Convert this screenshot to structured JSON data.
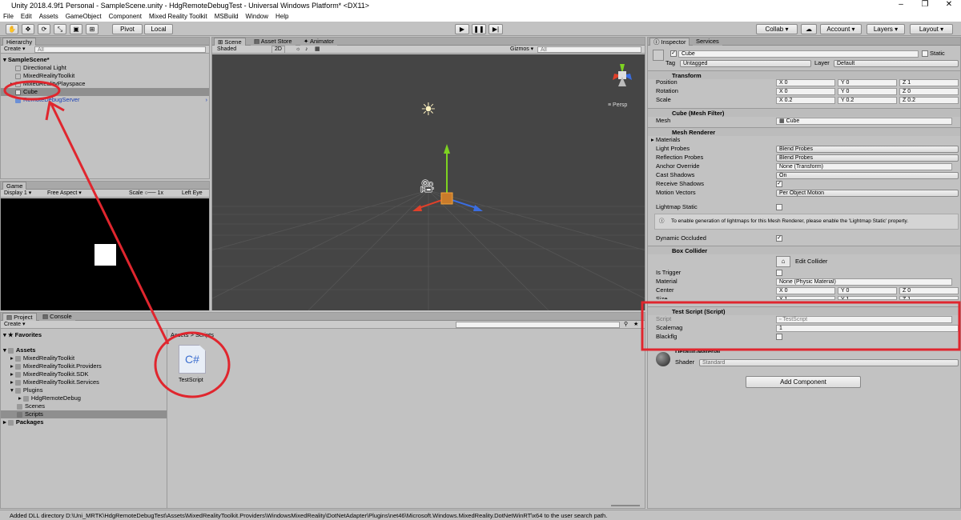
{
  "window": {
    "title": "Unity 2018.4.9f1 Personal - SampleScene.unity - HdgRemoteDebugTest - Universal Windows Platform* <DX11>"
  },
  "menu": [
    "File",
    "Edit",
    "Assets",
    "GameObject",
    "Component",
    "Mixed Reality Toolkit",
    "MSBuild",
    "Window",
    "Help"
  ],
  "toolbar": {
    "pivot": "Pivot",
    "local": "Local",
    "collab": "Collab",
    "account": "Account",
    "layers": "Layers",
    "layout": "Layout"
  },
  "hierarchy": {
    "tab": "Hierarchy",
    "create": "Create",
    "search": "All",
    "scene": "SampleScene*",
    "items": [
      "Directional Light",
      "MixedRealityToolkit",
      "MixedRealityPlayspace",
      "Cube",
      "RemoteDebugServer"
    ]
  },
  "scene": {
    "tabs": [
      "Scene",
      "Asset Store",
      "Animator"
    ],
    "shading": "Shaded",
    "mode2d": "2D",
    "gizmos": "Gizmos",
    "search": "All",
    "persp": "Persp"
  },
  "game": {
    "tab": "Game",
    "display": "Display 1",
    "aspect": "Free Aspect",
    "scale": "Scale",
    "scale_val": "1x",
    "eye": "Left Eye"
  },
  "project": {
    "tabs": [
      "Project",
      "Console"
    ],
    "create": "Create",
    "favorites": "Favorites",
    "assets": "Assets",
    "folders": [
      "MixedRealityToolkit",
      "MixedRealityToolkit.Providers",
      "MixedRealityToolkit.SDK",
      "MixedRealityToolkit.Services",
      "Plugins",
      "HdgRemoteDebug",
      "Scenes",
      "Scripts"
    ],
    "packages": "Packages",
    "breadcrumb": "Assets > Scripts",
    "file": "TestScript",
    "file_icon": "C#"
  },
  "inspector": {
    "tabs": [
      "Inspector",
      "Services"
    ],
    "name": "Cube",
    "static": "Static",
    "tag_label": "Tag",
    "tag": "Untagged",
    "layer_label": "Layer",
    "layer": "Default",
    "transform": {
      "title": "Transform",
      "labels": [
        "Position",
        "Rotation",
        "Scale"
      ],
      "values": [
        [
          "0",
          "0",
          "1"
        ],
        [
          "0",
          "0",
          "0"
        ],
        [
          "0.2",
          "0.2",
          "0.2"
        ]
      ]
    },
    "meshfilter": {
      "title": "Cube (Mesh Filter)",
      "label": "Mesh",
      "value": "Cube"
    },
    "renderer": {
      "title": "Mesh Renderer",
      "materials": "Materials",
      "rows": [
        [
          "Light Probes",
          "Blend Probes"
        ],
        [
          "Reflection Probes",
          "Blend Probes"
        ],
        [
          "Anchor Override",
          "None (Transform)"
        ],
        [
          "Cast Shadows",
          "On"
        ],
        [
          "Receive Shadows",
          ""
        ],
        [
          "Motion Vectors",
          "Per Object Motion"
        ]
      ],
      "lightmap": "Lightmap Static",
      "info": "To enable generation of lightmaps for this Mesh Renderer, please enable the 'Lightmap Static' property.",
      "dyn": "Dynamic Occluded"
    },
    "collider": {
      "title": "Box Collider",
      "edit": "Edit Collider",
      "trigger": "Is Trigger",
      "material_label": "Material",
      "material": "None (Physic Material)",
      "center": "Center",
      "size": "Size",
      "center_vals": [
        "0",
        "0",
        "0"
      ],
      "size_vals": [
        "1",
        "1",
        "1"
      ]
    },
    "script": {
      "title": "Test Script (Script)",
      "script_label": "Script",
      "script_val": "TestScript",
      "scalemag_label": "Scalemag",
      "scalemag": "1",
      "blackflg_label": "Blackflg"
    },
    "material": {
      "name": "Default-Material",
      "shader_label": "Shader",
      "shader": "Standard"
    },
    "add": "Add Component"
  },
  "status": "Added DLL directory D:\\Uni_MRTK\\HdgRemoteDebugTest\\Assets\\MixedRealityToolkit.Providers\\WindowsMixedReality\\DotNetAdapter\\Plugins\\net46\\Microsoft.Windows.MixedReality.DotNetWinRT\\x64 to the user search path.",
  "colors": {
    "annotation": "#e0262e",
    "scene_bg": "#454545",
    "selection": "#8f8f8f"
  }
}
